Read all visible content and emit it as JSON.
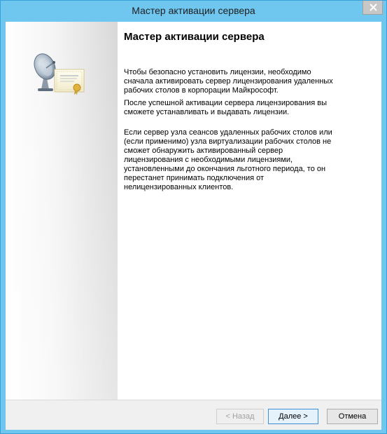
{
  "window": {
    "title": "Мастер активации сервера"
  },
  "page": {
    "heading": "Мастер активации сервера",
    "paragraph1": "Чтобы безопасно установить лицензии, необходимо сначала активировать сервер лицензирования удаленных рабочих столов в корпорации Майкрософт.",
    "paragraph2": "После успешной активации сервера лицензирования вы сможете устанавливать и выдавать лицензии.",
    "paragraph3": "Если сервер узла сеансов удаленных рабочих столов или (если применимо) узла виртуализации рабочих столов не сможет обнаружить активированный сервер лицензирования с необходимыми лицензиями, установленными до окончания льготного периода, то он перестанет принимать подключения от нелицензированных клиентов."
  },
  "buttons": {
    "back": "< Назад",
    "next": "Далее >",
    "cancel": "Отмена"
  },
  "icons": {
    "illustration": "satellite-dish-certificate-icon",
    "close": "close-icon"
  },
  "colors": {
    "titlebar": "#6fc7f0",
    "default_button_border": "#3c8fd6"
  }
}
